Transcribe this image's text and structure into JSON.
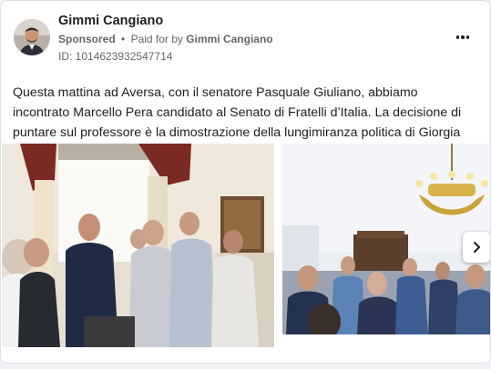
{
  "post": {
    "author": "Gimmi Cangiano",
    "sponsored_label": "Sponsored",
    "separator": "•",
    "paid_for_prefix": "Paid for by",
    "paid_for_by": "Gimmi Cangiano",
    "ad_id": "ID: 1014623932547714",
    "body": "Questa mattina ad Aversa, con il senatore Pasquale Giuliano, abbiamo incontrato Marcello Pera candidato al Senato di Fratelli d’Italia. La decisione di puntare sul professore è la dimostrazione della lungimiranza politica di Giorgia Meloni."
  },
  "icons": {
    "more": "more-options-icon",
    "next": "chevron-right-icon"
  },
  "colors": {
    "author_text": "#1c1e21",
    "secondary_text": "#65676b",
    "card_border": "#dddfe2"
  }
}
